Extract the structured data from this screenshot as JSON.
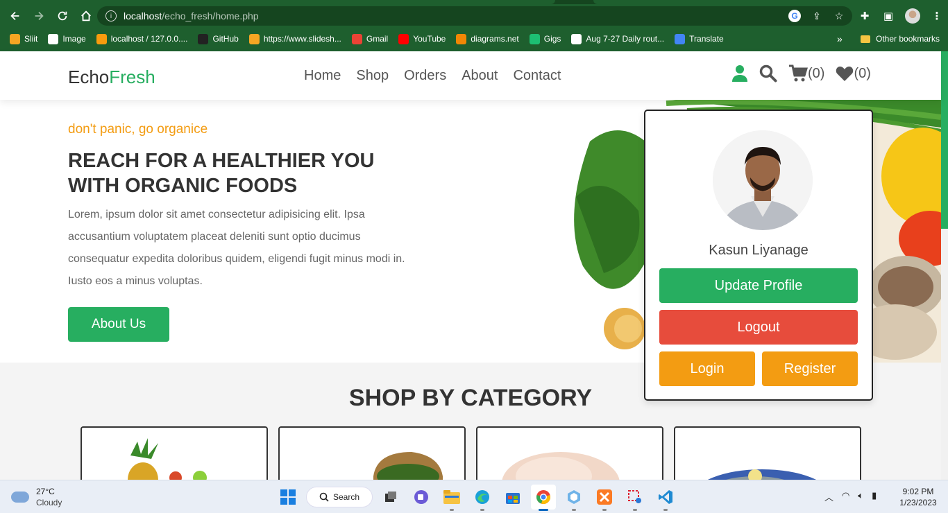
{
  "browser": {
    "url_host": "localhost",
    "url_path": "/echo_fresh/home.php",
    "bookmarks": [
      {
        "label": "Sliit",
        "icon": "sliit-icon",
        "color": "#f5a623"
      },
      {
        "label": "Image",
        "icon": "image-icon",
        "color": "#ffffff"
      },
      {
        "label": "localhost / 127.0.0....",
        "icon": "phpmyadmin-icon",
        "color": "#f89c0e"
      },
      {
        "label": "GitHub",
        "icon": "github-icon",
        "color": "#222222"
      },
      {
        "label": "https://www.slidesh...",
        "icon": "slideshare-icon",
        "color": "#f6a623"
      },
      {
        "label": "Gmail",
        "icon": "gmail-icon",
        "color": "#ea4335"
      },
      {
        "label": "YouTube",
        "icon": "youtube-icon",
        "color": "#ff0000"
      },
      {
        "label": "diagrams.net",
        "icon": "drawio-icon",
        "color": "#f08705"
      },
      {
        "label": "Gigs",
        "icon": "fiverr-icon",
        "color": "#1dbf73"
      },
      {
        "label": "Aug 7-27 Daily rout...",
        "icon": "google-icon",
        "color": "#ffffff"
      },
      {
        "label": "Translate",
        "icon": "translate-icon",
        "color": "#4285f4"
      }
    ],
    "more_bookmarks": "»",
    "other_bookmarks": "Other bookmarks"
  },
  "site": {
    "logo_part1": "Echo",
    "logo_part2": "Fresh",
    "brand_color": "#27ae60",
    "nav": [
      "Home",
      "Shop",
      "Orders",
      "About",
      "Contact"
    ],
    "cart_count": "(0)",
    "wishlist_count": "(0)"
  },
  "hero": {
    "tagline": "don't panic, go organice",
    "title": "REACH FOR A HEALTHIER YOU WITH ORGANIC FOODS",
    "text": "Lorem, ipsum dolor sit amet consectetur adipisicing elit. Ipsa accusantium voluptatem placeat deleniti sunt optio ducimus consequatur expedita doloribus quidem, eligendi fugit minus modi in. Iusto eos a minus voluptas.",
    "button": "About Us"
  },
  "category": {
    "heading": "SHOP BY CATEGORY",
    "cards": [
      "fruits",
      "herbs",
      "meat",
      "fish"
    ]
  },
  "profile": {
    "name": "Kasun Liyanage",
    "update": "Update Profile",
    "logout": "Logout",
    "login": "Login",
    "register": "Register"
  },
  "taskbar": {
    "temperature": "27°C",
    "weather": "Cloudy",
    "search": "Search",
    "time": "9:02 PM",
    "date": "1/23/2023"
  }
}
